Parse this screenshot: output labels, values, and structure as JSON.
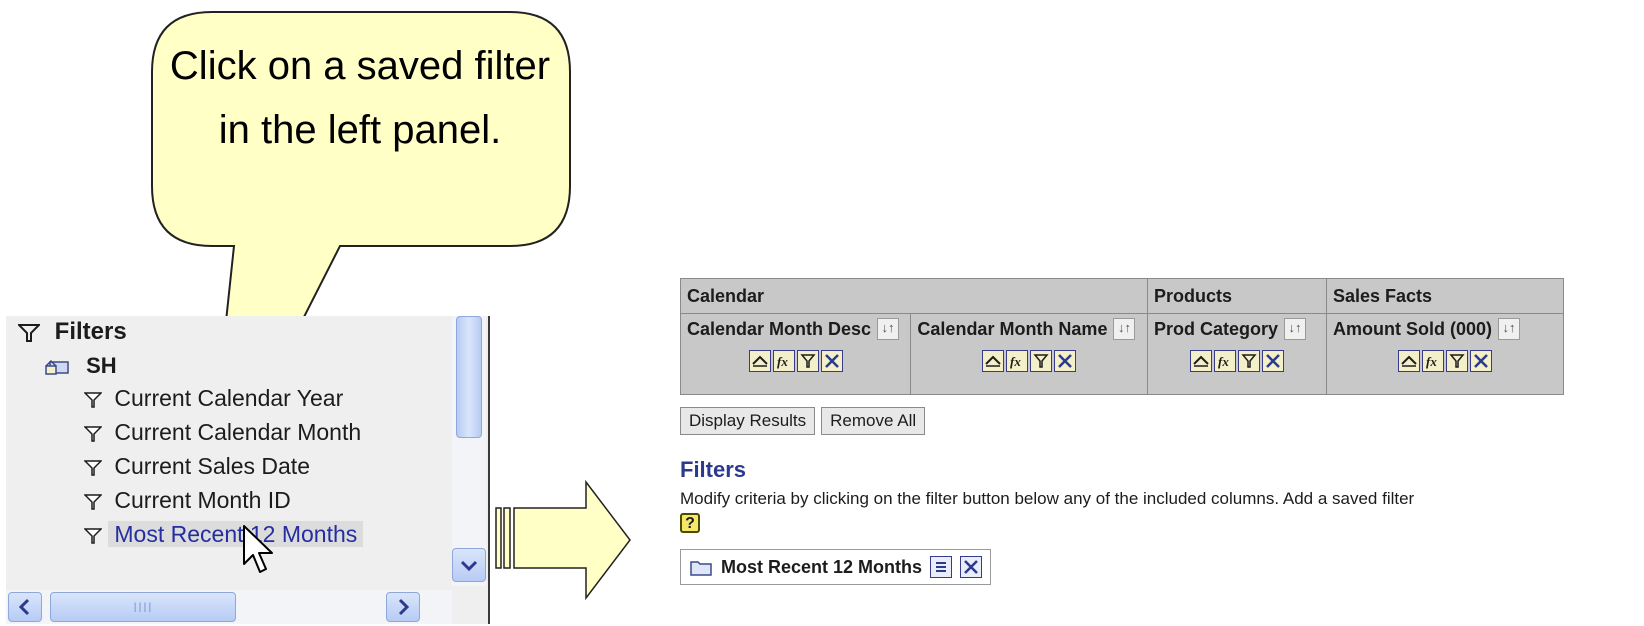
{
  "callout": {
    "text": "Click on a saved filter in the left panel."
  },
  "left_panel": {
    "root_label": "Filters",
    "subject_area": "SH",
    "items": [
      {
        "label": "Current Calendar Year",
        "selected": false
      },
      {
        "label": "Current Calendar Month",
        "selected": false
      },
      {
        "label": "Current Sales Date",
        "selected": false
      },
      {
        "label": "Current Month ID",
        "selected": false
      },
      {
        "label": "Most Recent 12 Months",
        "selected": true
      }
    ],
    "hscroll_grip": "IIII"
  },
  "criteria": {
    "groups": [
      "Calendar",
      "Products",
      "Sales Facts"
    ],
    "columns": [
      {
        "name": "Calendar Month Desc"
      },
      {
        "name": "Calendar Month Name"
      },
      {
        "name": "Prod Category"
      },
      {
        "name": "Amount Sold (000)"
      }
    ],
    "sort_glyph": "↓↑",
    "buttons": {
      "display_results": "Display Results",
      "remove_all": "Remove All"
    }
  },
  "filters": {
    "title": "Filters",
    "description": "Modify criteria by clicking on the filter button below any of the included columns. Add a saved filter",
    "help_glyph": "?",
    "saved_filter": "Most Recent 12 Months"
  },
  "colors": {
    "callout_fill": "#ffffc6",
    "selection_text": "#242ea0",
    "section_title": "#2b3a8c",
    "header_bg": "#c8c8c8"
  }
}
